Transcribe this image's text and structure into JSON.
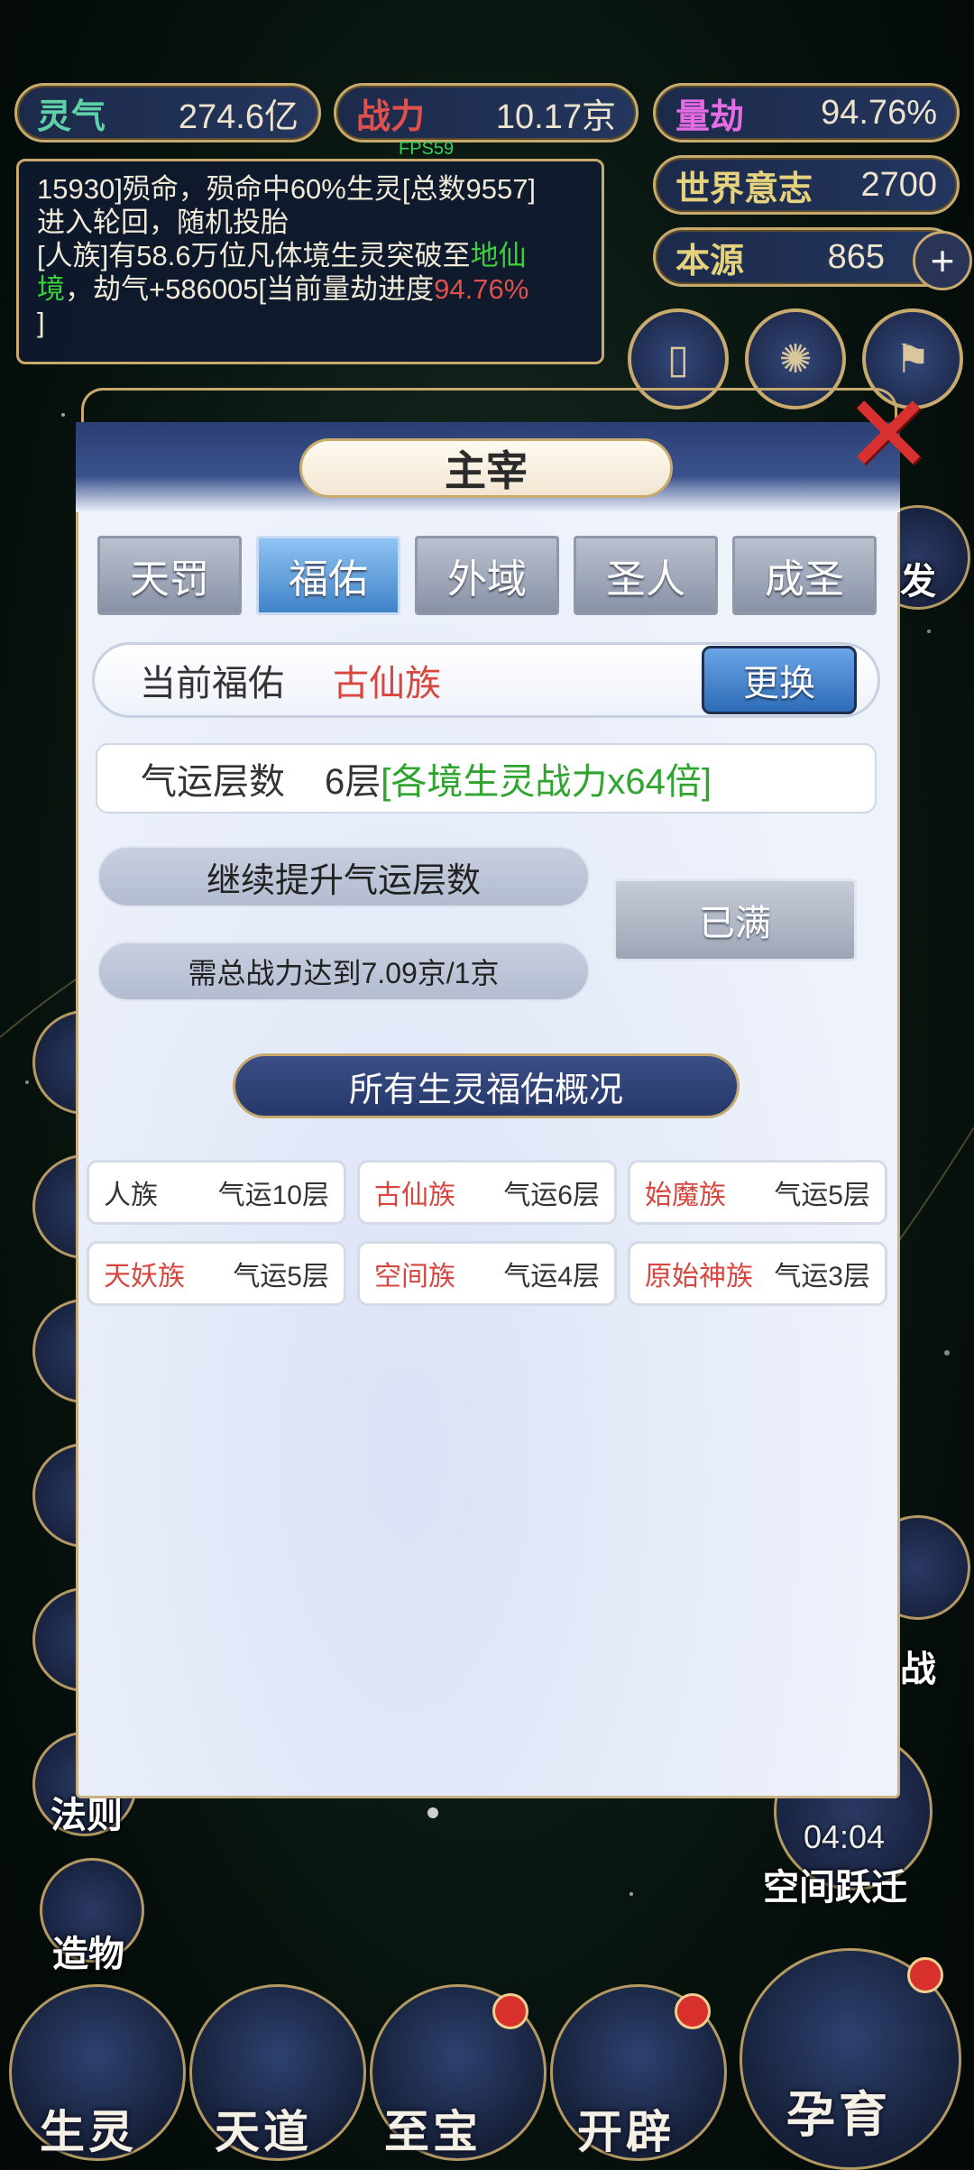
{
  "top_bar": {
    "lingqi": {
      "label": "灵气",
      "value": "274.6亿"
    },
    "zhanli": {
      "label": "战力",
      "value": "10.17京"
    },
    "liangjie": {
      "label": "量劫",
      "value": "94.76%"
    },
    "shijie": {
      "label": "世界意志",
      "value": "2700"
    },
    "benyuan": {
      "label": "本源",
      "value": "865"
    },
    "fps": "FPS59"
  },
  "log": {
    "line1": "15930]殒命，殒命中60%生灵[总数9557]",
    "line2": "进入轮回，随机投胎",
    "line3_prefix": "[人族]有58.6万位凡体境生灵突破至",
    "line3_green": "地仙",
    "line4_green": "境",
    "line4_mid": "，劫气+586005[当前量劫进度",
    "line4_red": "94.76%",
    "line5": "]"
  },
  "modal": {
    "title": "主宰",
    "tabs": [
      "天罚",
      "福佑",
      "外域",
      "圣人",
      "成圣"
    ],
    "active_tab": "福佑",
    "current_label": "当前福佑",
    "current_value": "古仙族",
    "change_button": "更换",
    "luck_label": "气运层数",
    "luck_value": "6层",
    "luck_bonus": "[各境生灵战力x64倍]",
    "upgrade_label": "继续提升气运层数",
    "requirement": "需总战力达到7.09京/1京",
    "full_button": "已满",
    "overview_title": "所有生灵福佑概况",
    "races": [
      {
        "name": "人族",
        "luck": "气运10层",
        "highlight": false
      },
      {
        "name": "古仙族",
        "luck": "气运6层",
        "highlight": true
      },
      {
        "name": "始魔族",
        "luck": "气运5层",
        "highlight": true
      },
      {
        "name": "天妖族",
        "luck": "气运5层",
        "highlight": true
      },
      {
        "name": "空间族",
        "luck": "气运4层",
        "highlight": true
      },
      {
        "name": "原始神族",
        "luck": "气运3层",
        "highlight": true
      }
    ]
  },
  "side_menu": {
    "right_partial_1": "发",
    "right_partial_2": "战",
    "left_law": "法则",
    "left_create": "造物",
    "space_jump": "空间跃迁",
    "timer": "04:04"
  },
  "bottom_nav": [
    "生灵",
    "天道",
    "至宝",
    "开辟",
    "孕育"
  ],
  "colors": {
    "accent_gold": "#c8aa6e",
    "highlight_red": "#d9463f",
    "bonus_green": "#2fa52f",
    "active_tab_blue": "#3f83c9"
  }
}
